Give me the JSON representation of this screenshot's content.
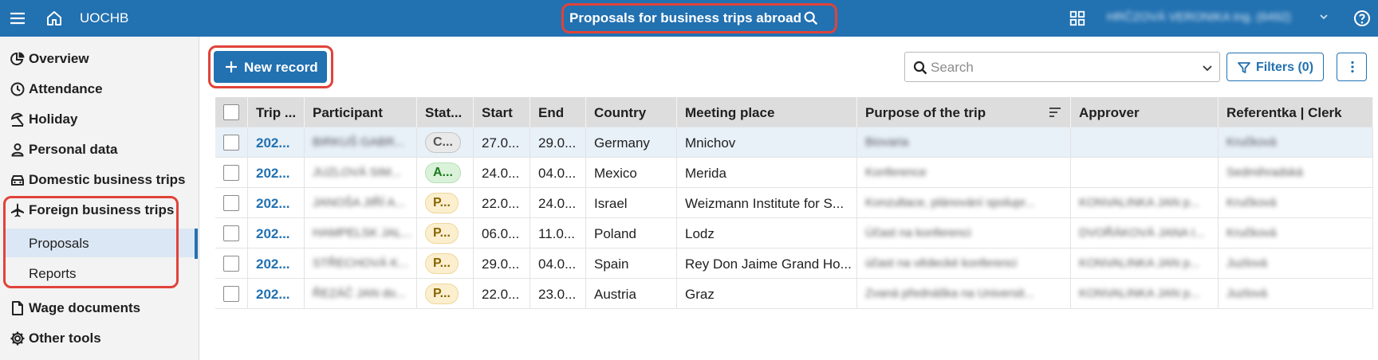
{
  "header": {
    "org_name": "UOCHB",
    "page_title": "Proposals for business trips abroad",
    "user_name": "HRČZOVÁ VERONIKA Ing. (6492)",
    "brand_color": "#2271b1",
    "icons": [
      "menu-icon",
      "home-icon",
      "search-icon",
      "apps-grid-icon",
      "chevron-down-icon",
      "help-icon"
    ]
  },
  "sidebar": {
    "items": [
      {
        "label": "Overview",
        "icon": "pie-chart-icon"
      },
      {
        "label": "Attendance",
        "icon": "clock-icon"
      },
      {
        "label": "Holiday",
        "icon": "beach-umbrella-icon"
      },
      {
        "label": "Personal data",
        "icon": "person-icon"
      },
      {
        "label": "Domestic business trips",
        "icon": "car-icon"
      },
      {
        "label": "Foreign business trips",
        "icon": "airplane-icon"
      },
      {
        "label": "Wage documents",
        "icon": "document-icon"
      },
      {
        "label": "Other tools",
        "icon": "gear-icon"
      }
    ],
    "sub_items": [
      {
        "label": "Proposals",
        "active": true
      },
      {
        "label": "Reports",
        "active": false
      }
    ]
  },
  "toolbar": {
    "new_record_label": "New record",
    "search_placeholder": "Search",
    "filters_label": "Filters (0)"
  },
  "table": {
    "columns": [
      "Trip ...",
      "Participant",
      "Stat...",
      "Start",
      "End",
      "Country",
      "Meeting place",
      "Purpose of the trip",
      "Approver",
      "Referentka | Clerk"
    ],
    "rows": [
      {
        "trip": "202...",
        "participant": "BIRKUŠ GABR...",
        "status": "C...",
        "status_color": "grey",
        "start": "27.0...",
        "end": "29.0...",
        "country": "Germany",
        "meeting_place": "Mnichov",
        "purpose": "Biovaria",
        "approver": "",
        "clerk": "Kručková",
        "selected": true
      },
      {
        "trip": "202...",
        "participant": "JUZLOVÁ SIM...",
        "status": "A...",
        "status_color": "green",
        "start": "24.0...",
        "end": "04.0...",
        "country": "Mexico",
        "meeting_place": "Merida",
        "purpose": "Konference",
        "approver": "",
        "clerk": "Sedmihradská",
        "selected": false
      },
      {
        "trip": "202...",
        "participant": "JANOŠA JIŘÍ A...",
        "status": "P...",
        "status_color": "yellow",
        "start": "22.0...",
        "end": "24.0...",
        "country": "Israel",
        "meeting_place": "Weizmann Institute for S...",
        "purpose": "Konzultace, plánování spolupr...",
        "approver": "KONVALINKA JAN p...",
        "clerk": "Kručková",
        "selected": false
      },
      {
        "trip": "202...",
        "participant": "HAMPELSK JAL...",
        "status": "P...",
        "status_color": "yellow",
        "start": "06.0...",
        "end": "11.0...",
        "country": "Poland",
        "meeting_place": "Lodz",
        "purpose": "Účast na konferenci",
        "approver": "DVOŘÁKOVÁ JANA I...",
        "clerk": "Kručková",
        "selected": false
      },
      {
        "trip": "202...",
        "participant": "STŘECHOVÁ K...",
        "status": "P...",
        "status_color": "yellow",
        "start": "29.0...",
        "end": "04.0...",
        "country": "Spain",
        "meeting_place": "Rey Don Jaime Grand Ho...",
        "purpose": "účast na vědecké konferenci",
        "approver": "KONVALINKA JAN p...",
        "clerk": "Juzlová",
        "selected": false
      },
      {
        "trip": "202...",
        "participant": "ŘEZÁČ JAN do...",
        "status": "P...",
        "status_color": "yellow",
        "start": "22.0...",
        "end": "23.0...",
        "country": "Austria",
        "meeting_place": "Graz",
        "purpose": "Zvaná přednáška na Universit...",
        "approver": "KONVALINKA JAN p...",
        "clerk": "Juzlová",
        "selected": false
      }
    ]
  }
}
